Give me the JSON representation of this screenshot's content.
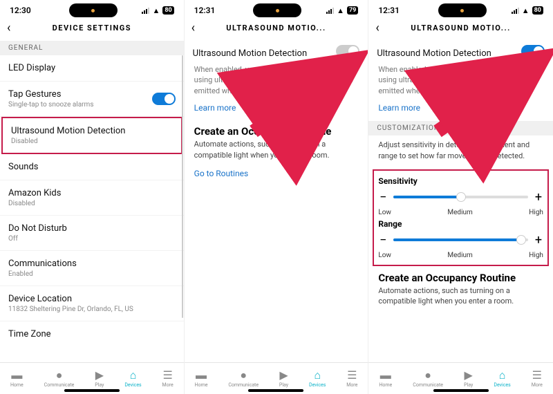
{
  "tabbar": {
    "home": "Home",
    "communicate": "Communicate",
    "play": "Play",
    "devices": "Devices",
    "more": "More"
  },
  "screen1": {
    "time": "12:30",
    "battery": "80",
    "title": "DEVICE SETTINGS",
    "section_general": "GENERAL",
    "led": "LED Display",
    "tap_title": "Tap Gestures",
    "tap_sub": "Single-tap to snooze alarms",
    "umd_title": "Ultrasound Motion Detection",
    "umd_sub": "Disabled",
    "sounds": "Sounds",
    "kids_title": "Amazon Kids",
    "kids_sub": "Disabled",
    "dnd_title": "Do Not Disturb",
    "dnd_sub": "Off",
    "comm_title": "Communications",
    "comm_sub": "Enabled",
    "loc_title": "Device Location",
    "loc_sub": "11832 Sheltering Pine Dr, Orlando, FL, US",
    "tz_title": "Time Zone"
  },
  "screen2": {
    "time": "12:31",
    "battery": "79",
    "title": "ULTRASOUND MOTIO...",
    "umd_label": "Ultrasound Motion Detection",
    "desc": "When enabled, your device will detect motion using ultrasound technology. Ultrasound will be emitted when you turn on features that use it.",
    "learn_more": "Learn more",
    "create_title": "Create an Occupancy Routine",
    "create_desc": "Automate actions, such as turning on a compatible light when you enter a room.",
    "go_routines": "Go to Routines"
  },
  "screen3": {
    "time": "12:31",
    "battery": "80",
    "title": "ULTRASOUND MOTIO...",
    "umd_label": "Ultrasound Motion Detection",
    "desc": "When enabled, your device will detect motion using ultrasound technology. Ultrasound will be emitted when you turn on features that use it.",
    "learn_more": "Learn more",
    "customizations": "CUSTOMIZATIONS",
    "custom_desc": "Adjust sensitivity in detecting movement and range to set how far movement is detected.",
    "sensitivity": "Sensitivity",
    "range": "Range",
    "low": "Low",
    "medium": "Medium",
    "high": "High",
    "create_title": "Create an Occupancy Routine",
    "create_desc": "Automate actions, such as turning on a compatible light when you enter a room.",
    "sensitivity_pct": 50,
    "range_pct": 95
  }
}
